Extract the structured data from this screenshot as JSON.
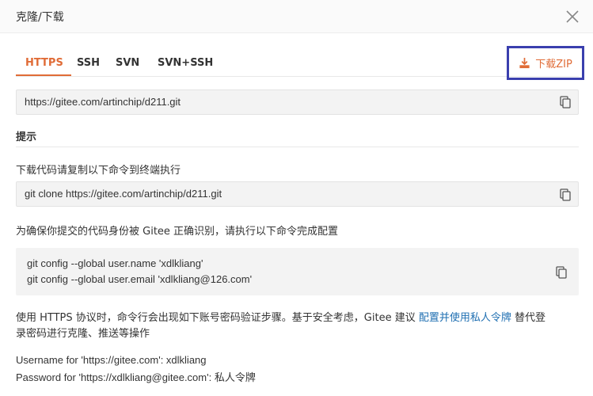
{
  "dialog": {
    "title": "克隆/下载"
  },
  "tabs": [
    {
      "label": "HTTPS"
    },
    {
      "label": "SSH"
    },
    {
      "label": "SVN"
    },
    {
      "label": "SVN+SSH"
    }
  ],
  "download_zip_label": "下载ZIP",
  "repo_url": "https://gitee.com/artinchip/d211.git",
  "tip": {
    "title": "提示",
    "copy_instruction": "下载代码请复制以下命令到终端执行",
    "clone_command": "git clone https://gitee.com/artinchip/d211.git",
    "config_instruction": "为确保你提交的代码身份被 Gitee 正确识别，请执行以下命令完成配置",
    "config_line1": "git config --global user.name 'xdlkliang'",
    "config_line2": "git config --global user.email 'xdlkliang@126.com'",
    "https_note_part1": "使用 HTTPS 协议时，命令行会出现如下账号密码验证步骤。基于安全考虑，Gitee 建议 ",
    "https_note_link": "配置并使用私人令牌",
    "https_note_part2": " 替代登",
    "https_note_line2": "录密码进行克隆、推送等操作",
    "username_line": "Username for 'https://gitee.com': xdlkliang",
    "password_line": "Password for 'https://xdlkliang@gitee.com': 私人令牌"
  },
  "colors": {
    "accent": "#e06c37",
    "highlight_border": "#3a3fae",
    "link": "#1f6fb2"
  },
  "icons": {
    "close": "close-icon",
    "download": "download-icon",
    "copy": "copy-icon"
  }
}
